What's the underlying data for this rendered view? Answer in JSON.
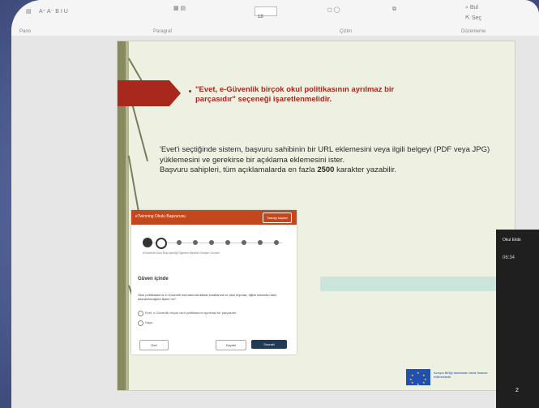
{
  "ribbon": {
    "groups": [
      "Pano",
      "Paragraf",
      "Çizim",
      "Düzenleme"
    ],
    "find_label": "Bul",
    "select_label": "Seç",
    "font_size": "18"
  },
  "slide": {
    "headline": "\"Evet, e-Güvenlik birçok okul politikasının ayrılmaz bir parçasıdır\" seçeneği işaretlenmelidir.",
    "paragraph_1": "'Evet'i seçtiğinde sistem, başvuru sahibinin bir URL eklemesini veya ilgili belgeyi (PDF veya JPG) yüklemesini ve gerekirse bir açıklama eklemesini ister.",
    "paragraph_2_prefix": "Başvuru sahipleri, tüm açıklamalarda en fazla",
    "paragraph_2_number": "2500",
    "paragraph_2_suffix": "karakter yazabilir."
  },
  "form": {
    "header_title": "eTwinning Okulu Başvurusu",
    "save_label": "Taslağı kaydet",
    "step_labels": "eGüvenlik   Okul   Ekip   İşbirliği   Öğretim   Mesleki Gelişim   Gönder",
    "section_title": "Güven içinde",
    "question": "Okul politikalarınız e-Güvenlik konularında dikkat kurallarına ve okul dışında, dijital ortamda nasıl davranılacağına ilişkin mi?",
    "option_yes": "Evet, e-Güvenlik birçok okul politikasının ayrılmaz bir parçasıdır",
    "option_no": "Hayır",
    "back_label": "Geri",
    "mid_label": "Kaydet",
    "next_label": "Sonraki"
  },
  "eu": {
    "text": "Avrupa Birliği tarafından ortak finanse edilmektedir"
  },
  "video": {
    "name": "Okul Ekibi",
    "time": "06:34",
    "badge": "2"
  }
}
